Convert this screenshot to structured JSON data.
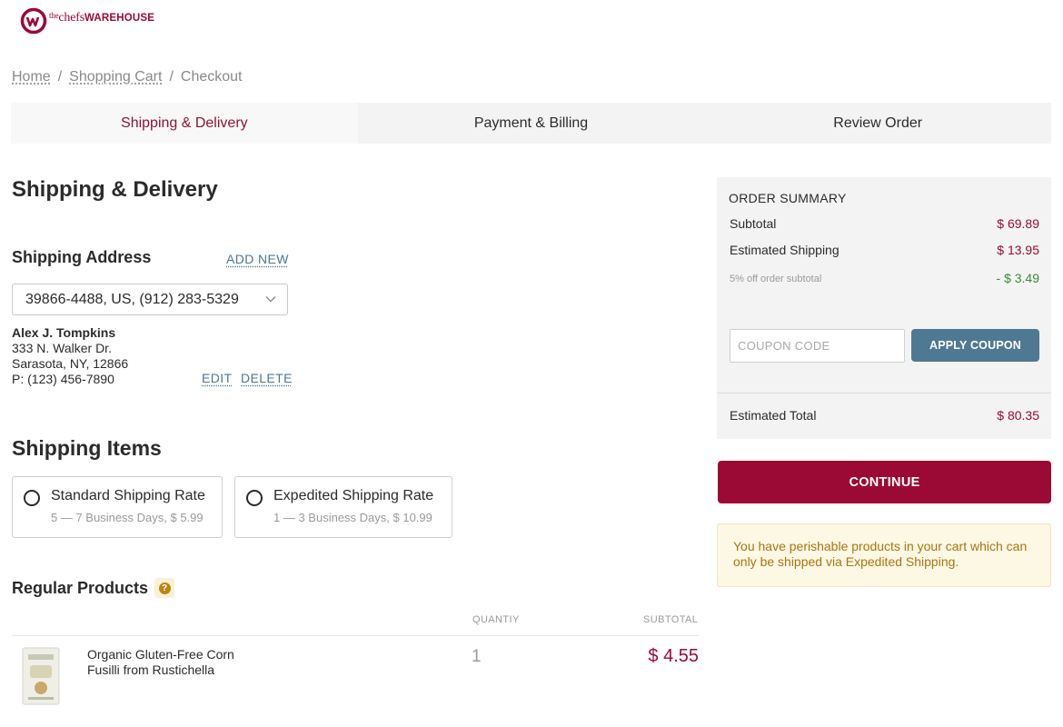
{
  "brand": {
    "logo_prefix": "the",
    "logo_name": "chefs",
    "logo_bold": "WAREHOUSE",
    "accent_color": "#9b0a35",
    "secondary_color": "#4f7892"
  },
  "breadcrumb": {
    "items": [
      "Home",
      "Shopping Cart",
      "Checkout"
    ],
    "separator": "/"
  },
  "steps": {
    "items": [
      "Shipping & Delivery",
      "Payment & Billing",
      "Review Order"
    ],
    "active": "Shipping & Delivery"
  },
  "page": {
    "title": "Shipping & Delivery"
  },
  "shipping_address": {
    "heading": "Shipping Address",
    "add_new_label": "ADD NEW",
    "selected": "39866-4488, US, (912) 283-5329",
    "name": "Alex J. Tompkins",
    "line1": "333 N. Walker Dr.",
    "line2": "Sarasota, NY, 12866",
    "phone": "P: (123) 456-7890",
    "edit_label": "EDIT",
    "delete_label": "DELETE"
  },
  "shipping_items": {
    "heading": "Shipping Items",
    "rates": [
      {
        "title": "Standard Shipping Rate",
        "detail": "5 — 7 Business Days, $ 5.99",
        "selected": false
      },
      {
        "title": "Expedited Shipping Rate",
        "detail": "1 — 3 Business Days, $ 10.99",
        "selected": false
      }
    ]
  },
  "products": {
    "heading": "Regular Products",
    "help_icon": "question-icon",
    "columns": {
      "quantity": "QUANTIY",
      "subtotal": "SUBTOTAL"
    },
    "rows": [
      {
        "name": "Organic Gluten-Free Corn Fusilli from Rustichella",
        "quantity": "1",
        "subtotal": "$ 4.55"
      }
    ]
  },
  "order_summary": {
    "title": "ORDER SUMMARY",
    "subtotal_label": "Subtotal",
    "subtotal_value": "$ 69.89",
    "shipping_label": "Estimated Shipping",
    "shipping_value": "$ 13.95",
    "discount_label": "5% off order subtotal",
    "discount_value": "- $ 3.49",
    "coupon_placeholder": "COUPON CODE",
    "coupon_button": "APPLY COUPON",
    "total_label": "Estimated Total",
    "total_value": "$ 80.35"
  },
  "actions": {
    "continue_label": "CONTINUE"
  },
  "notice": {
    "text": "You have perishable products in your cart which can only be shipped via Expedited Shipping."
  }
}
